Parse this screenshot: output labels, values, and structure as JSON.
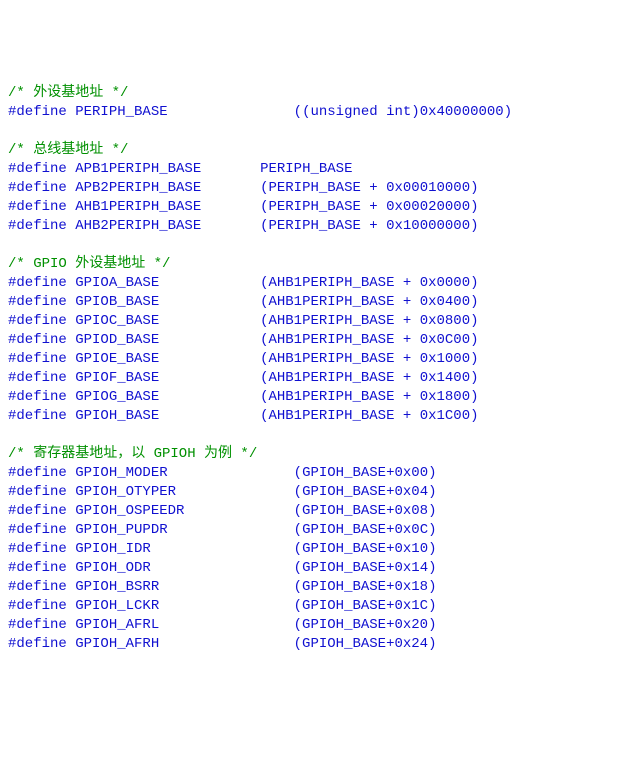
{
  "sections": [
    {
      "comment": "/* 外设基地址 */",
      "lines": [
        {
          "kw": "#define",
          "name": "PERIPH_BASE",
          "pad1": 15,
          "value": "((unsigned int)0x40000000)"
        }
      ]
    },
    {
      "comment": "/* 总线基地址 */",
      "lines": [
        {
          "kw": "#define",
          "name": "APB1PERIPH_BASE",
          "pad1": 7,
          "value": "PERIPH_BASE"
        },
        {
          "kw": "#define",
          "name": "APB2PERIPH_BASE",
          "pad1": 7,
          "value": "(PERIPH_BASE + 0x00010000)"
        },
        {
          "kw": "#define",
          "name": "AHB1PERIPH_BASE",
          "pad1": 7,
          "value": "(PERIPH_BASE + 0x00020000)"
        },
        {
          "kw": "#define",
          "name": "AHB2PERIPH_BASE",
          "pad1": 7,
          "value": "(PERIPH_BASE + 0x10000000)"
        }
      ]
    },
    {
      "comment": "/* GPIO 外设基地址 */",
      "lines": [
        {
          "kw": "#define",
          "name": "GPIOA_BASE",
          "pad1": 12,
          "value": "(AHB1PERIPH_BASE + 0x0000)"
        },
        {
          "kw": "#define",
          "name": "GPIOB_BASE",
          "pad1": 12,
          "value": "(AHB1PERIPH_BASE + 0x0400)"
        },
        {
          "kw": "#define",
          "name": "GPIOC_BASE",
          "pad1": 12,
          "value": "(AHB1PERIPH_BASE + 0x0800)"
        },
        {
          "kw": "#define",
          "name": "GPIOD_BASE",
          "pad1": 12,
          "value": "(AHB1PERIPH_BASE + 0x0C00)"
        },
        {
          "kw": "#define",
          "name": "GPIOE_BASE",
          "pad1": 12,
          "value": "(AHB1PERIPH_BASE + 0x1000)"
        },
        {
          "kw": "#define",
          "name": "GPIOF_BASE",
          "pad1": 12,
          "value": "(AHB1PERIPH_BASE + 0x1400)"
        },
        {
          "kw": "#define",
          "name": "GPIOG_BASE",
          "pad1": 12,
          "value": "(AHB1PERIPH_BASE + 0x1800)"
        },
        {
          "kw": "#define",
          "name": "GPIOH_BASE",
          "pad1": 12,
          "value": "(AHB1PERIPH_BASE + 0x1C00)"
        }
      ]
    },
    {
      "comment": "/* 寄存器基地址，以 GPIOH 为例 */",
      "lines": [
        {
          "kw": "#define",
          "name": "GPIOH_MODER",
          "pad1": 15,
          "value": "(GPIOH_BASE+0x00)"
        },
        {
          "kw": "#define",
          "name": "GPIOH_OTYPER",
          "pad1": 14,
          "value": "(GPIOH_BASE+0x04)"
        },
        {
          "kw": "#define",
          "name": "GPIOH_OSPEEDR",
          "pad1": 13,
          "value": "(GPIOH_BASE+0x08)"
        },
        {
          "kw": "#define",
          "name": "GPIOH_PUPDR",
          "pad1": 15,
          "value": "(GPIOH_BASE+0x0C)"
        },
        {
          "kw": "#define",
          "name": "GPIOH_IDR",
          "pad1": 17,
          "value": "(GPIOH_BASE+0x10)"
        },
        {
          "kw": "#define",
          "name": "GPIOH_ODR",
          "pad1": 17,
          "value": "(GPIOH_BASE+0x14)"
        },
        {
          "kw": "#define",
          "name": "GPIOH_BSRR",
          "pad1": 16,
          "value": "(GPIOH_BASE+0x18)"
        },
        {
          "kw": "#define",
          "name": "GPIOH_LCKR",
          "pad1": 16,
          "value": "(GPIOH_BASE+0x1C)"
        },
        {
          "kw": "#define",
          "name": "GPIOH_AFRL",
          "pad1": 16,
          "value": "(GPIOH_BASE+0x20)"
        },
        {
          "kw": "#define",
          "name": "GPIOH_AFRH",
          "pad1": 16,
          "value": "(GPIOH_BASE+0x24)"
        }
      ]
    }
  ]
}
